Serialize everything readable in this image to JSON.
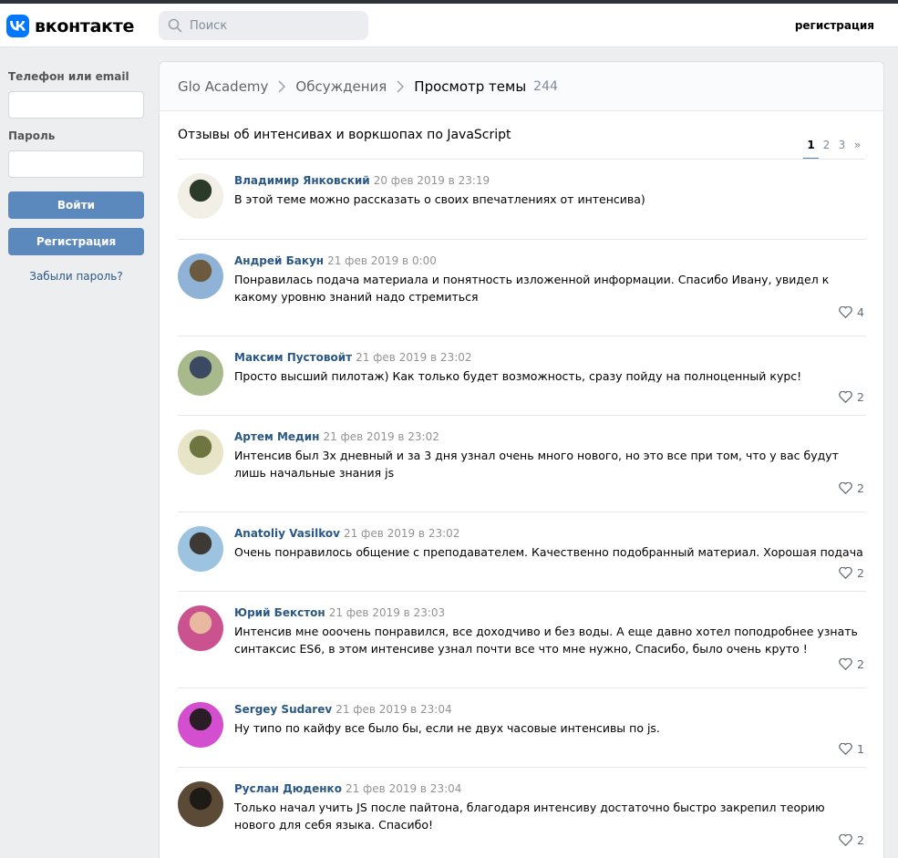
{
  "header": {
    "logo_text": "вконтакте",
    "search_placeholder": "Поиск",
    "register_link": "регистрация"
  },
  "login": {
    "phone_label": "Телефон или email",
    "password_label": "Пароль",
    "login_button": "Войти",
    "register_button": "Регистрация",
    "forgot_link": "Забыли пароль?"
  },
  "breadcrumb": {
    "group": "Glo Academy",
    "section": "Обсуждения",
    "current": "Просмотр темы",
    "count": "244"
  },
  "topic": {
    "title": "Отзывы об интенсивах и воркшопах по JavaScript",
    "pages": [
      "1",
      "2",
      "3",
      "»"
    ]
  },
  "posts": [
    {
      "author": "Владимир Янковский",
      "date": "20 фев 2019 в 23:19",
      "text": "В этой теме можно рассказать о своих впечатлениях от интенсива)",
      "likes": "",
      "avatar_colors": [
        "#f1efe6",
        "#2c3a2a"
      ]
    },
    {
      "author": "Андрей Бакун",
      "date": "21 фев 2019 в 0:00",
      "text": "Понравилась подача материала и понятность изложенной информации. Спасибо Ивану, увидел к какому уровню знаний надо стремиться",
      "likes": "4",
      "avatar_colors": [
        "#8fb2d6",
        "#6b5a3e"
      ]
    },
    {
      "author": "Максим Пустовойт",
      "date": "21 фев 2019 в 23:02",
      "text": "Просто высший пилотаж) Как только будет возможность, сразу пойду на полноценный курс!",
      "likes": "2",
      "avatar_colors": [
        "#a8b98c",
        "#3b4a62"
      ]
    },
    {
      "author": "Артем Медин",
      "date": "21 фев 2019 в 23:02",
      "text": "Интенсив был 3х дневный и за 3 дня узнал очень много нового, но это все при том, что у вас будут лишь начальные знания js",
      "likes": "2",
      "avatar_colors": [
        "#e8e4c8",
        "#6e7540"
      ]
    },
    {
      "author": "Anatoliy Vasilkov",
      "date": "21 фев 2019 в 23:02",
      "text": "Очень понравилось общение с преподавателем. Качественно подобранный материал. Хорошая подача",
      "likes": "2",
      "avatar_colors": [
        "#9cc3e0",
        "#3d3a35"
      ]
    },
    {
      "author": "Юрий Бекстон",
      "date": "21 фев 2019 в 23:03",
      "text": "Интенсив мне ооочень понравился, все доходчиво и без воды. А еще давно хотел поподробнее узнать синтаксис ES6, в этом интенсиве узнал почти все что мне нужно, Спасибо, было очень круто !",
      "likes": "2",
      "avatar_colors": [
        "#c9528f",
        "#e8b9a0"
      ]
    },
    {
      "author": "Sergey Sudarev",
      "date": "21 фев 2019 в 23:04",
      "text": "Ну типо по кайфу все было бы, если не двух часовые интенсивы по js.",
      "likes": "1",
      "avatar_colors": [
        "#d44fd0",
        "#2a1d26"
      ]
    },
    {
      "author": "Руслан Дюденко",
      "date": "21 фев 2019 в 23:04",
      "text": "Только начал учить JS после пайтона, благодаря интенсиву достаточно быстро закрепил теорию нового для себя языка. Спасибо!",
      "likes": "2",
      "avatar_colors": [
        "#5a4a36",
        "#1e1a16"
      ]
    }
  ]
}
